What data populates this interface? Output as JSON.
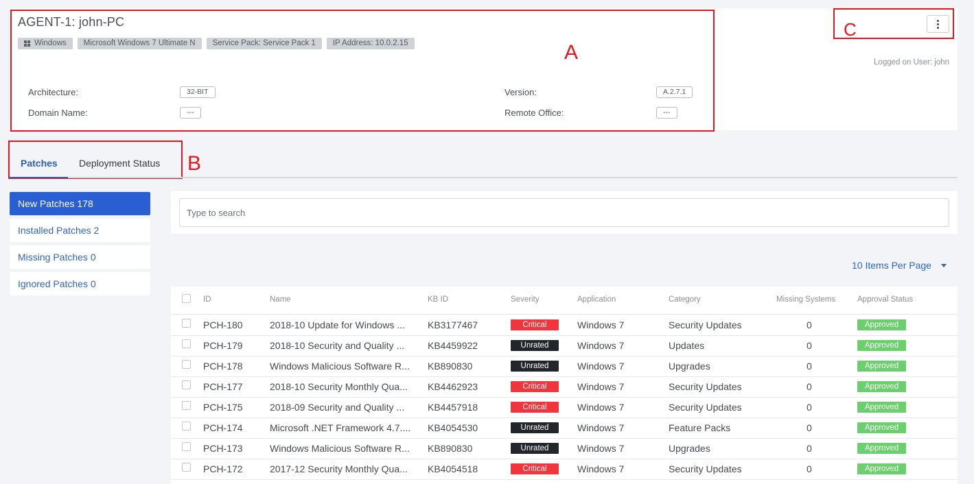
{
  "agent": {
    "title": "AGENT-1: john-PC",
    "tags": [
      "Windows",
      "Microsoft Windows 7 Ultimate N",
      "Service Pack: Service Pack 1",
      "IP Address: 10.0.2.15"
    ],
    "logged_on_user": "Logged on User: john",
    "fields": {
      "architecture_label": "Architecture:",
      "architecture_value": "32-BIT",
      "domain_label": "Domain Name:",
      "domain_value": "---",
      "version_label": "Version:",
      "version_value": "A.2.7.1",
      "remote_office_label": "Remote Office:",
      "remote_office_value": "---"
    }
  },
  "annotations": {
    "a": "A",
    "b": "B",
    "c": "C",
    "color": "#e3171e"
  },
  "tabs": [
    {
      "label": "Patches",
      "active": true
    },
    {
      "label": "Deployment Status",
      "active": false
    }
  ],
  "sidebar": {
    "items": [
      {
        "label": "New Patches 178",
        "active": true
      },
      {
        "label": "Installed Patches 2"
      },
      {
        "label": "Missing Patches 0"
      },
      {
        "label": "Ignored Patches 0"
      }
    ]
  },
  "search": {
    "placeholder": "Type to search",
    "value": ""
  },
  "pagination": {
    "per_page_label": "10 Items Per Page"
  },
  "table": {
    "columns": [
      "ID",
      "Name",
      "KB ID",
      "Severity",
      "Application",
      "Category",
      "Missing Systems",
      "Approval Status"
    ],
    "rows": [
      {
        "id": "PCH-180",
        "name": "2018-10 Update for Windows ...",
        "kb": "KB3177467",
        "severity": "Critical",
        "application": "Windows 7",
        "category": "Security Updates",
        "missing": "0",
        "approval": "Approved"
      },
      {
        "id": "PCH-179",
        "name": "2018-10 Security and Quality ...",
        "kb": "KB4459922",
        "severity": "Unrated",
        "application": "Windows 7",
        "category": "Updates",
        "missing": "0",
        "approval": "Approved"
      },
      {
        "id": "PCH-178",
        "name": "Windows Malicious Software R...",
        "kb": "KB890830",
        "severity": "Unrated",
        "application": "Windows 7",
        "category": "Upgrades",
        "missing": "0",
        "approval": "Approved"
      },
      {
        "id": "PCH-177",
        "name": "2018-10 Security Monthly Qua...",
        "kb": "KB4462923",
        "severity": "Critical",
        "application": "Windows 7",
        "category": "Security Updates",
        "missing": "0",
        "approval": "Approved"
      },
      {
        "id": "PCH-175",
        "name": "2018-09 Security and Quality ...",
        "kb": "KB4457918",
        "severity": "Critical",
        "application": "Windows 7",
        "category": "Security Updates",
        "missing": "0",
        "approval": "Approved"
      },
      {
        "id": "PCH-174",
        "name": "Microsoft .NET Framework 4.7....",
        "kb": "KB4054530",
        "severity": "Unrated",
        "application": "Windows 7",
        "category": "Feature Packs",
        "missing": "0",
        "approval": "Approved"
      },
      {
        "id": "PCH-173",
        "name": "Windows Malicious Software R...",
        "kb": "KB890830",
        "severity": "Unrated",
        "application": "Windows 7",
        "category": "Upgrades",
        "missing": "0",
        "approval": "Approved"
      },
      {
        "id": "PCH-172",
        "name": "2017-12 Security Monthly Qua...",
        "kb": "KB4054518",
        "severity": "Critical",
        "application": "Windows 7",
        "category": "Security Updates",
        "missing": "0",
        "approval": "Approved"
      }
    ]
  },
  "colors": {
    "accent": "#2a5fd4",
    "critical": "#f0353c",
    "unrated": "#22262a",
    "approved": "#6ccf6e"
  },
  "icons": {
    "os": "windows-icon",
    "more": "more-vertical-icon",
    "dropdown": "caret-down-icon"
  }
}
